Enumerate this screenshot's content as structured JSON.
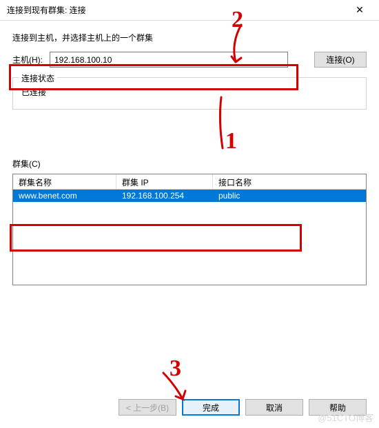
{
  "title": "连接到现有群集: 连接",
  "instruction": "连接到主机，并选择主机上的一个群集",
  "host": {
    "label": "主机(H):",
    "value": "192.168.100.10",
    "connect_btn": "连接(O)"
  },
  "status_group": {
    "title": "连接状态",
    "status": "已连接"
  },
  "cluster": {
    "label": "群集(C)",
    "columns": {
      "name": "群集名称",
      "ip": "群集 IP",
      "iface": "接口名称"
    },
    "rows": [
      {
        "name": "www.benet.com",
        "ip": "192.168.100.254",
        "iface": "public"
      }
    ]
  },
  "buttons": {
    "back": "< 上一步(B)",
    "finish": "完成",
    "cancel": "取消",
    "help": "帮助"
  },
  "annotations": {
    "one": "1",
    "two": "2",
    "three": "3"
  },
  "watermark": "@51CTO博客"
}
